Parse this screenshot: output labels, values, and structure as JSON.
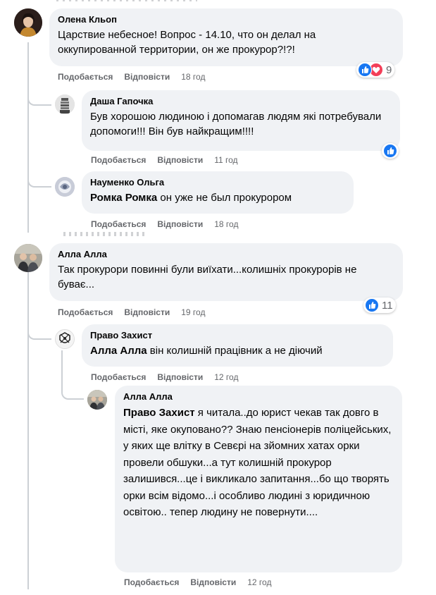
{
  "labels": {
    "like": "Подобається",
    "reply": "Відповісти"
  },
  "colors": {
    "bubble": "#f0f2f5",
    "muted": "#65676b",
    "like_blue": "#1877f2",
    "love_red": "#f33e58",
    "thread_line": "#ccd0d5"
  },
  "comments": [
    {
      "author": "Олена Кльоп",
      "text": "Царствие небесное! Вопрос - 14.10, что он делал на оккупированной территории, он же прокурор?!?!",
      "time": "18 год",
      "reactions": {
        "icons": [
          "like-icon",
          "love-icon"
        ],
        "count": "9"
      }
    },
    {
      "author": "Даша Гапочка",
      "text": "Був хорошою людиною і допомагав людям які потребували допомоги!!! Він був найкращим!!!!",
      "time": "11 год",
      "reactions": {
        "icons": [
          "like-icon"
        ]
      }
    },
    {
      "author": "Науменко Ольга",
      "mention": "Ромка Ромка",
      "text": " он уже не был прокурором",
      "time": "18 год"
    },
    {
      "author": "Алла Алла",
      "text": "Так прокурори повинні були виїхати...колишніх прокурорів не буває...",
      "time": "19 год",
      "reactions": {
        "icons": [
          "like-icon"
        ],
        "count": "11"
      }
    },
    {
      "author": "Право Захист",
      "mention": "Алла Алла",
      "text": " він колишній працівник а не діючий",
      "time": "12 год"
    },
    {
      "author": "Алла Алла",
      "mention": "Право Захист",
      "text": " я читала..до юрист чекав так довго в місті, яке окуповано?? Знаю пенсіонерів поліцейських, у яких ще влітку в Севєрі на зйомних хатах орки провели обшуки...а тут колишній прокурор залишився...це і викликало запитання...бо що творять орки всім відомо...і особливо людині з юридичною освітою.. тепер людину не повернути....",
      "time": "12 год"
    }
  ]
}
